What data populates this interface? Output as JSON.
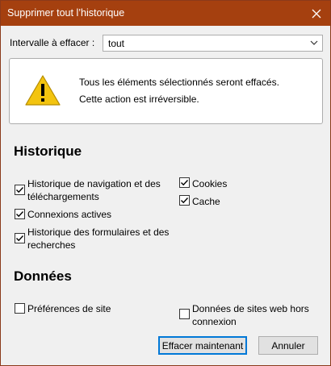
{
  "window": {
    "title": "Supprimer tout l’historique"
  },
  "range": {
    "label": "Intervalle à effacer :",
    "value": "tout"
  },
  "warning": {
    "line1": "Tous les éléments sélectionnés seront effacés.",
    "line2": "Cette action est irréversible."
  },
  "history": {
    "title": "Historique",
    "items": [
      {
        "label": "Historique de navigation et des\ntéléchargements",
        "checked": true
      },
      {
        "label": "Connexions actives",
        "checked": true
      },
      {
        "label": "Historique des formulaires et des\nrecherches",
        "checked": true
      },
      {
        "label": "Cookies",
        "checked": true
      },
      {
        "label": "Cache",
        "checked": true
      }
    ]
  },
  "data_section": {
    "title": "Données",
    "items": [
      {
        "label": "Préférences de site",
        "checked": false
      },
      {
        "label": "Données de sites web hors\nconnexion",
        "checked": false
      }
    ]
  },
  "buttons": {
    "confirm": "Effacer maintenant",
    "cancel": "Annuler"
  },
  "colors": {
    "titlebar": "#a5400f",
    "warning": "#f3c40f",
    "accent": "#0078d7"
  }
}
